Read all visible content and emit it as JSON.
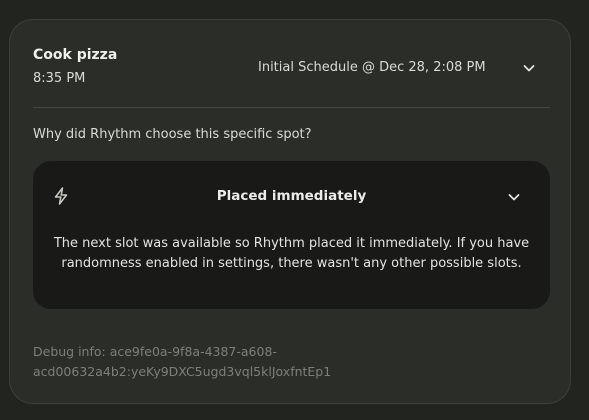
{
  "task": {
    "title": "Cook pizza",
    "time": "8:35 PM",
    "schedule_label": "Initial Schedule @ Dec 28, 2:08 PM"
  },
  "question": "Why did Rhythm choose this specific spot?",
  "reason": {
    "title": "Placed immediately",
    "icon": "bolt-icon",
    "text": "The next slot was available so Rhythm placed it immediately. If you have randomness enabled in settings, there wasn't any other possible slots."
  },
  "debug": {
    "line1": "Debug info: ace9fe0a-9f8a-4387-a608-",
    "line2": "acd00632a4b2:yeKy9DXC5ugd3vql5klJoxfntEp1"
  },
  "colors": {
    "background": "#222420",
    "card": "#2b2d29",
    "reason_box": "#191a17",
    "muted_text": "#7d8079"
  }
}
